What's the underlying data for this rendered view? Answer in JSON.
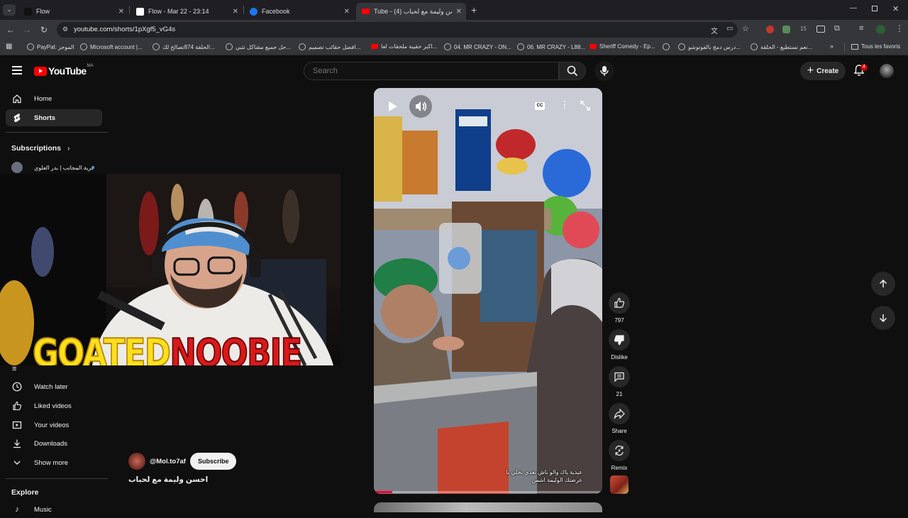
{
  "browser": {
    "tabs": [
      {
        "title": "Flow",
        "active": false
      },
      {
        "title": "Flow - Mar 22 - 23:14",
        "active": false
      },
      {
        "title": "Facebook",
        "active": false
      },
      {
        "title": "Tube - احسن وليمة مع لحباب (4)",
        "active": true
      }
    ],
    "url": "youtube.com/shorts/1pXgf5_vG4s",
    "extension_badge": "15",
    "bookmarks": [
      "PayPal: الموجز",
      "Microsoft account |...",
      "الحلقة 874تصالح لك...",
      "حل جميع مشاكل تثبي...",
      "افضل حقائب تصميم...",
      "اكبر حقيبة ملحقات لعا...",
      "04. MR CRAZY - ON...",
      "06. MR CRAZY - L88...",
      "Sheriff Comedy - Ep...",
      "درس دمج بالفوتوشو...",
      "نعم نستطيع - الحلقة..."
    ],
    "all_favorites": "Tous les favoris"
  },
  "header": {
    "logo_text": "YouTube",
    "country_code": "MA",
    "search_placeholder": "Search",
    "create_label": "Create",
    "notification_count": "4"
  },
  "sidebar": {
    "home": "Home",
    "shorts": "Shorts",
    "subscriptions_title": "Subscriptions",
    "subscription_channel": "ـرية المجانب | بدر العلوي",
    "watch_later": "Watch later",
    "liked_videos": "Liked videos",
    "your_videos": "Your videos",
    "downloads": "Downloads",
    "show_more": "Show more",
    "explore_title": "Explore",
    "music": "Music"
  },
  "overlay": {
    "streamer_name_part1": "GOATED",
    "streamer_name_part2": "NOOBIE"
  },
  "short": {
    "channel_handle": "@Mol.to7af",
    "subscribe_label": "Subscribe",
    "title": "احسن وليمة مع لحباب",
    "caption_line1": "عيدية ياك والو باش نعدي نخلي با",
    "caption_line2": "عرضتك الوليمة اشمن",
    "likes": "797",
    "dislike_label": "Dislike",
    "comments": "21",
    "share_label": "Share",
    "remix_label": "Remix",
    "cc_label": "CC",
    "progress": 0.08
  }
}
